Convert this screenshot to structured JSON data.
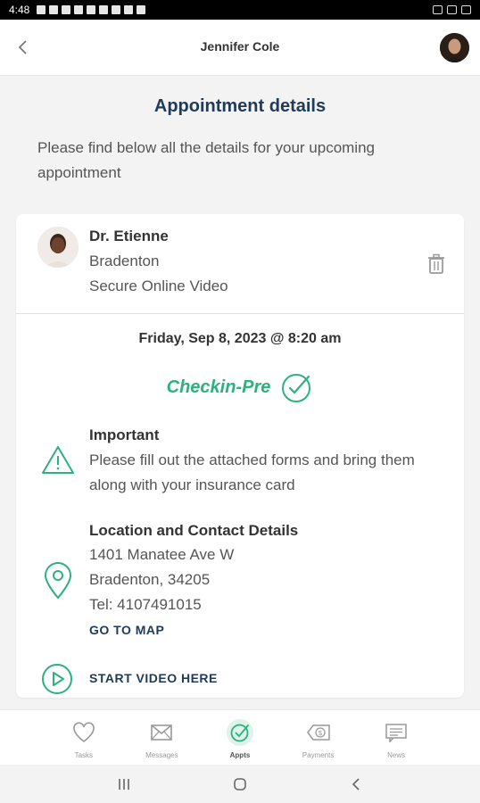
{
  "status_bar": {
    "time": "4:48"
  },
  "header": {
    "title": "Jennifer Cole"
  },
  "page": {
    "heading": "Appointment details",
    "intro": "Please find below all the details for your upcoming appointment"
  },
  "appointment": {
    "doctor": "Dr. Etienne",
    "location_name": "Bradenton",
    "visit_type": "Secure Online Video",
    "datetime": "Friday, Sep 8, 2023 @ 8:20 am",
    "status": "Checkin-Pre",
    "important_title": "Important",
    "important_text": "Please fill out the attached forms and bring them along with your insurance card",
    "location_title": "Location and Contact Details",
    "address_line1": "1401 Manatee Ave W",
    "address_line2": "Bradenton, 34205",
    "phone": "Tel: 4107491015",
    "map_link": "GO TO MAP",
    "video_link": "START VIDEO HERE"
  },
  "nav": {
    "items": [
      {
        "label": "Tasks",
        "icon": "heart-icon"
      },
      {
        "label": "Messages",
        "icon": "envelope-icon"
      },
      {
        "label": "Appts",
        "icon": "clock-check-icon"
      },
      {
        "label": "Payments",
        "icon": "dollar-tag-icon"
      },
      {
        "label": "News",
        "icon": "news-icon"
      }
    ],
    "active": "Appts"
  },
  "colors": {
    "accent": "#2bb27e",
    "heading": "#1f3b57",
    "background": "#f3f3f3"
  }
}
